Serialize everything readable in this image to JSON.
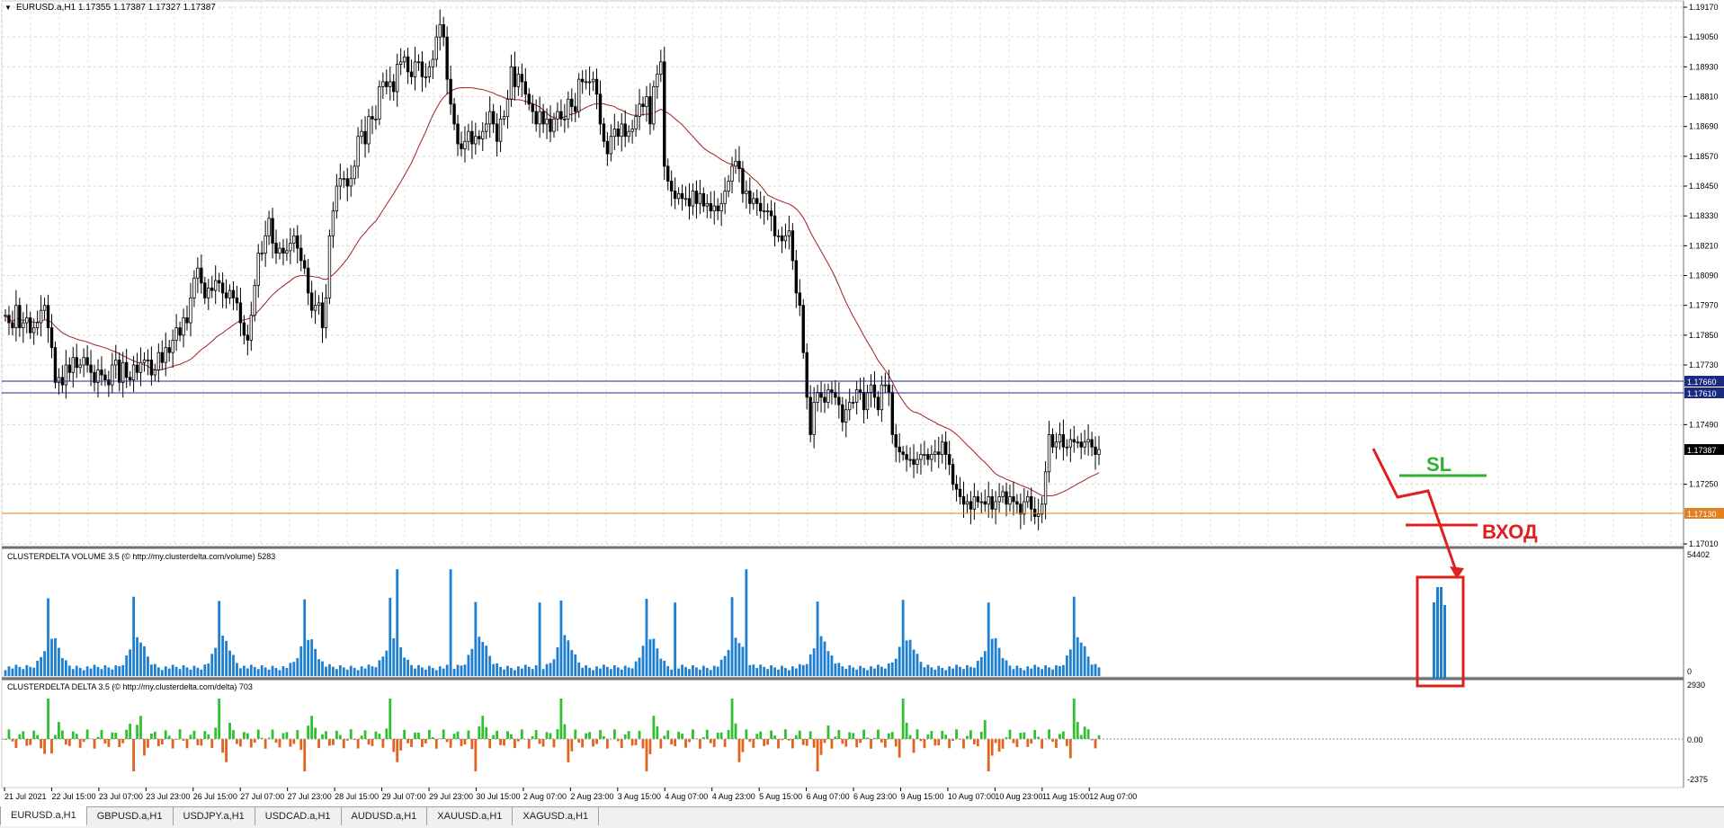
{
  "chart": {
    "symbol_header": "EURUSD.a,H1  1.17355 1.17387 1.17327 1.17387",
    "price_scale": [
      "1.19170",
      "1.19050",
      "1.18930",
      "1.18810",
      "1.18690",
      "1.18570",
      "1.18450",
      "1.18330",
      "1.18210",
      "1.18090",
      "1.17970",
      "1.17850",
      "1.17730",
      "1.17490",
      "1.17250",
      "1.17010"
    ],
    "price_tags": {
      "upper_line": "1.17660",
      "lower_line": "1.17610",
      "current": "1.17387",
      "entry_line": "1.17130"
    },
    "colors": {
      "bull": "#000000",
      "ma": "#a02020",
      "hline": "#1a2a80",
      "entry_line": "#e08020",
      "volume": "#1e7fd0",
      "delta_pos": "#2fbf2f",
      "delta_neg": "#e0641e",
      "annotation_red": "#e02020",
      "annotation_green": "#30b030"
    }
  },
  "annotations": {
    "sl_label": "SL",
    "entry_label": "ВХОД"
  },
  "volume_panel": {
    "title": "CLUSTERDELTA VOLUME 3.5 (© http://my.clusterdelta.com/volume) 5283",
    "scale_top": "54402",
    "scale_bottom": "0"
  },
  "delta_panel": {
    "title": "CLUSTERDELTA DELTA 3.5 (© http://my.clusterdelta.com/delta) 703",
    "scale_top": "2930",
    "scale_mid": "0.00",
    "scale_bottom": "-2375"
  },
  "time_axis": [
    "21 Jul 2021",
    "22 Jul 15:00",
    "23 Jul 07:00",
    "23 Jul 23:00",
    "26 Jul 15:00",
    "27 Jul 07:00",
    "27 Jul 23:00",
    "28 Jul 15:00",
    "29 Jul 07:00",
    "29 Jul 23:00",
    "30 Jul 15:00",
    "2 Aug 07:00",
    "2 Aug 23:00",
    "3 Aug 15:00",
    "4 Aug 07:00",
    "4 Aug 23:00",
    "5 Aug 15:00",
    "6 Aug 07:00",
    "6 Aug 23:00",
    "9 Aug 15:00",
    "10 Aug 07:00",
    "10 Aug 23:00",
    "11 Aug 15:00",
    "12 Aug 07:00"
  ],
  "tabs": [
    "EURUSD.a,H1",
    "GBPUSD.a,H1",
    "USDJPY.a,H1",
    "USDCAD.a,H1",
    "AUDUSD.a,H1",
    "XAUUSD.a,H1",
    "XAGUSD.a,H1"
  ],
  "series": {
    "closes": [
      1.1793,
      1.179,
      1.1788,
      1.1797,
      1.1788,
      1.179,
      1.1792,
      1.1786,
      1.1788,
      1.179,
      1.1795,
      1.1797,
      1.1788,
      1.178,
      1.1766,
      1.1768,
      1.1765,
      1.1773,
      1.177,
      1.1776,
      1.1772,
      1.1773,
      1.1776,
      1.1773,
      1.177,
      1.1766,
      1.1771,
      1.1769,
      1.1767,
      1.1765,
      1.1773,
      1.1775,
      1.1766,
      1.1774,
      1.1768,
      1.1767,
      1.1773,
      1.177,
      1.1774,
      1.1775,
      1.1775,
      1.1769,
      1.1771,
      1.1778,
      1.1774,
      1.178,
      1.1778,
      1.1783,
      1.1788,
      1.1785,
      1.1792,
      1.179,
      1.18,
      1.1808,
      1.1812,
      1.1806,
      1.18,
      1.1804,
      1.1803,
      1.1807,
      1.1806,
      1.1802,
      1.18,
      1.1803,
      1.18,
      1.1798,
      1.179,
      1.1785,
      1.1783,
      1.1793,
      1.1805,
      1.1818,
      1.1818,
      1.1825,
      1.1832,
      1.1822,
      1.1818,
      1.182,
      1.1818,
      1.1819,
      1.1822,
      1.1825,
      1.182,
      1.1815,
      1.1812,
      1.1802,
      1.1795,
      1.1797,
      1.1798,
      1.1788,
      1.18,
      1.1825,
      1.1835,
      1.1845,
      1.1848,
      1.1848,
      1.1845,
      1.1848,
      1.1853,
      1.1865,
      1.1867,
      1.1862,
      1.1873,
      1.1872,
      1.1872,
      1.1885,
      1.1887,
      1.1885,
      1.1887,
      1.1883,
      1.1894,
      1.1895,
      1.1897,
      1.1891,
      1.1889,
      1.1895,
      1.1895,
      1.1889,
      1.1889,
      1.1893,
      1.1896,
      1.1905,
      1.191,
      1.1905,
      1.1888,
      1.1878,
      1.187,
      1.1862,
      1.186,
      1.1863,
      1.1867,
      1.1862,
      1.1865,
      1.1864,
      1.1867,
      1.187,
      1.1875,
      1.187,
      1.1863,
      1.1872,
      1.1873,
      1.188,
      1.1893,
      1.1885,
      1.189,
      1.1887,
      1.1882,
      1.1878,
      1.1875,
      1.187,
      1.1875,
      1.187,
      1.1872,
      1.1867,
      1.1872,
      1.1875,
      1.1872,
      1.1872,
      1.188,
      1.1877,
      1.1875,
      1.1888,
      1.1887,
      1.1887,
      1.1887,
      1.1888,
      1.1882,
      1.187,
      1.1863,
      1.1858,
      1.1865,
      1.1868,
      1.1865,
      1.187,
      1.1865,
      1.1867,
      1.1868,
      1.1873,
      1.1878,
      1.1877,
      1.1881,
      1.187,
      1.1885,
      1.189,
      1.1895,
      1.1853,
      1.1847,
      1.1843,
      1.184,
      1.1842,
      1.184,
      1.184,
      1.1837,
      1.1843,
      1.1838,
      1.1842,
      1.1837,
      1.1838,
      1.1835,
      1.1837,
      1.1835,
      1.1838,
      1.1843,
      1.1847,
      1.1853,
      1.1855,
      1.1852,
      1.1842,
      1.1843,
      1.1838,
      1.184,
      1.1838,
      1.1835,
      1.1835,
      1.1835,
      1.1833,
      1.1825,
      1.1825,
      1.1823,
      1.1825,
      1.1827,
      1.1815,
      1.1802,
      1.1797,
      1.1778,
      1.176,
      1.1745,
      1.1758,
      1.1762,
      1.176,
      1.1758,
      1.1763,
      1.1762,
      1.176,
      1.1757,
      1.175,
      1.1755,
      1.1758,
      1.1758,
      1.1763,
      1.1762,
      1.1755,
      1.1762,
      1.1765,
      1.176,
      1.1755,
      1.1765,
      1.1765,
      1.1762,
      1.1745,
      1.174,
      1.1738,
      1.1737,
      1.1735,
      1.1735,
      1.1733,
      1.1735,
      1.1737,
      1.1737,
      1.1735,
      1.1737,
      1.1738,
      1.1737,
      1.1742,
      1.1737,
      1.1733,
      1.1725,
      1.1723,
      1.172,
      1.1717,
      1.1718,
      1.1715,
      1.172,
      1.1718,
      1.1718,
      1.1717,
      1.172,
      1.1715,
      1.1718,
      1.172,
      1.1722,
      1.1717,
      1.172,
      1.1718,
      1.1717,
      1.1713,
      1.1718,
      1.172,
      1.1715,
      1.1712,
      1.1713,
      1.1717,
      1.173,
      1.1745,
      1.174,
      1.1742,
      1.1745,
      1.174,
      1.174,
      1.1743,
      1.1742,
      1.1742,
      1.174,
      1.1742,
      1.1743,
      1.174,
      1.1737,
      1.1739
    ]
  }
}
